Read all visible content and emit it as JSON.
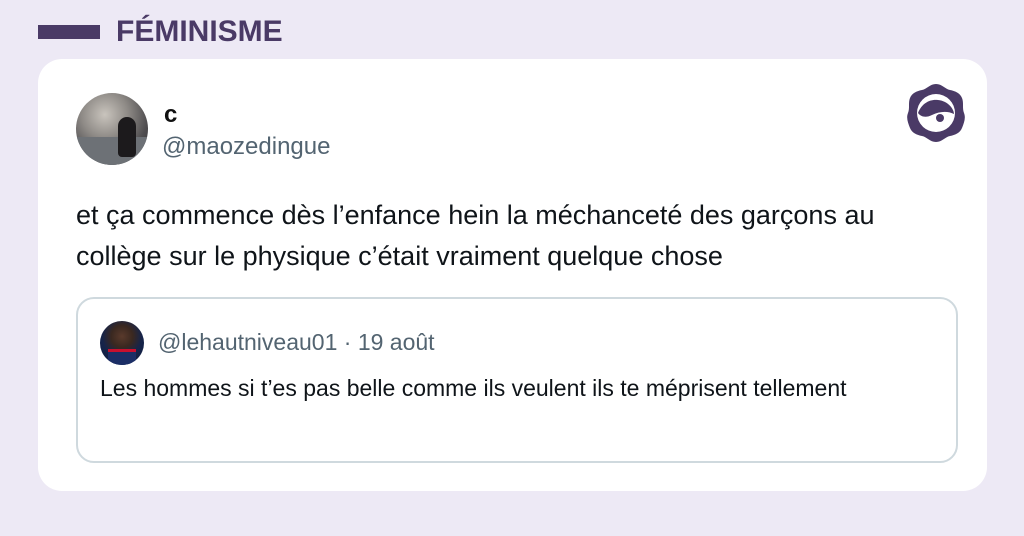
{
  "category": {
    "label": "FÉMINISME"
  },
  "tweet": {
    "display_name": "c",
    "handle": "@maozedingue",
    "text": "et ça commence dès l’enfance hein la méchanceté des garçons au collège sur le physique c’était vraiment quelque chose"
  },
  "quoted_tweet": {
    "handle": "@lehautniveau01",
    "separator": " · ",
    "date": "19 août",
    "text": "Les hommes si t’es pas belle comme ils veulent ils te méprisent tellement"
  },
  "icons": {
    "brand_logo": "flower-eye-logo-icon"
  },
  "colors": {
    "background": "#ede9f5",
    "accent": "#4a3a66",
    "card": "#ffffff",
    "secondary_text": "#536471",
    "quote_border": "#cfd9de"
  }
}
